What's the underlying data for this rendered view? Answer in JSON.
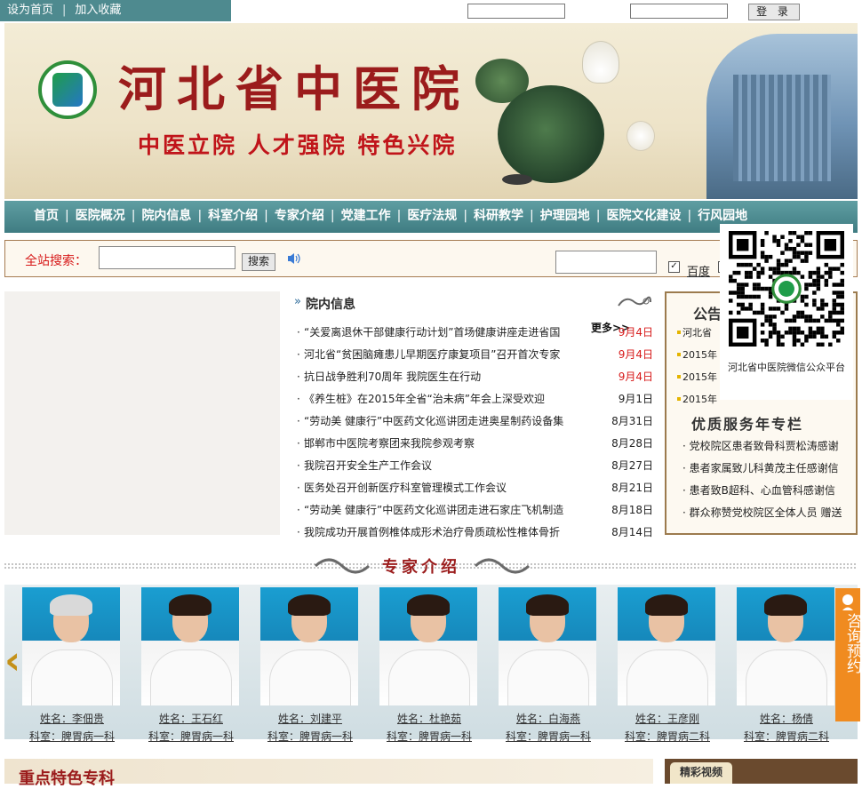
{
  "topbar": {
    "set_homepage": "设为首页",
    "separator": "|",
    "add_favorite": "加入收藏",
    "login_label": "登 录"
  },
  "banner": {
    "title": "河北省中医院",
    "slogan": "中医立院 人才强院 特色兴院"
  },
  "nav": {
    "items": [
      "首页",
      "医院概况",
      "院内信息",
      "科室介绍",
      "专家介绍",
      "党建工作",
      "医疗法规",
      "科研教学",
      "护理园地",
      "医院文化建设",
      "行风园地"
    ]
  },
  "search": {
    "label": "全站搜索：",
    "button": "搜索",
    "baidu_label": "百度"
  },
  "news": {
    "heading": "院内信息",
    "more": "更多>>",
    "items": [
      {
        "title": "“关爱离退休干部健康行动计划”首场健康讲座走进省国",
        "date": "9月4日",
        "highlight": true
      },
      {
        "title": "河北省“贫困脑瘫患儿早期医疗康复项目”召开首次专家",
        "date": "9月4日",
        "highlight": true
      },
      {
        "title": "抗日战争胜利70周年 我院医生在行动",
        "date": "9月4日",
        "highlight": true
      },
      {
        "title": "《养生桩》在2015年全省“治未病”年会上深受欢迎",
        "date": "9月1日",
        "highlight": false
      },
      {
        "title": "“劳动美 健康行”中医药文化巡讲团走进奥星制药设备集",
        "date": "8月31日",
        "highlight": false
      },
      {
        "title": "邯郸市中医院考察团来我院参观考察",
        "date": "8月28日",
        "highlight": false
      },
      {
        "title": "我院召开安全生产工作会议",
        "date": "8月27日",
        "highlight": false
      },
      {
        "title": "医务处召开创新医疗科室管理模式工作会议",
        "date": "8月21日",
        "highlight": false
      },
      {
        "title": "“劳动美 健康行”中医药文化巡讲团走进石家庄飞机制造",
        "date": "8月18日",
        "highlight": false
      },
      {
        "title": "我院成功开展首例椎体成形术治疗骨质疏松性椎体骨折",
        "date": "8月14日",
        "highlight": false
      }
    ],
    "highlight_color": "#d71a1a"
  },
  "notice": {
    "heading": "公告",
    "items": [
      "河北省",
      "2015年",
      "2015年",
      "2015年"
    ],
    "service_heading": "优质服务年专栏",
    "service_items": [
      "· 党校院区患者致骨科贾松涛感谢",
      "· 患者家属致儿科黄茂主任感谢信",
      "· 患者致B超科、心血管科感谢信",
      "· 群众称赞党校院区全体人员 赠送"
    ]
  },
  "qr": {
    "caption": "河北省中医院微信公众平台"
  },
  "experts": {
    "heading": "专家介绍",
    "list": [
      {
        "name": "姓名：李佃贵",
        "dept": "科室：脾胃病一科",
        "hair": "#d9d9d9"
      },
      {
        "name": "姓名：王石红",
        "dept": "科室：脾胃病一科",
        "hair": "#2a1a12"
      },
      {
        "name": "姓名：刘建平",
        "dept": "科室：脾胃病一科",
        "hair": "#2a1a12"
      },
      {
        "name": "姓名：杜艳茹",
        "dept": "科室：脾胃病一科",
        "hair": "#2a1a12"
      },
      {
        "name": "姓名：白海燕",
        "dept": "科室：脾胃病一科",
        "hair": "#2a1a12"
      },
      {
        "name": "姓名：王彦刚",
        "dept": "科室：脾胃病二科",
        "hair": "#2a1a12"
      },
      {
        "name": "姓名：杨倩",
        "dept": "科室：脾胃病二科",
        "hair": "#2a1a12"
      }
    ]
  },
  "consult": {
    "label": "咨询预约"
  },
  "bottom": {
    "featured_heading": "重点特色专科",
    "video_tab": "精彩视频"
  },
  "colors": {
    "nav_teal": "#4e8a8f",
    "accent_red": "#d71a1a",
    "consult_orange": "#f08b20"
  }
}
